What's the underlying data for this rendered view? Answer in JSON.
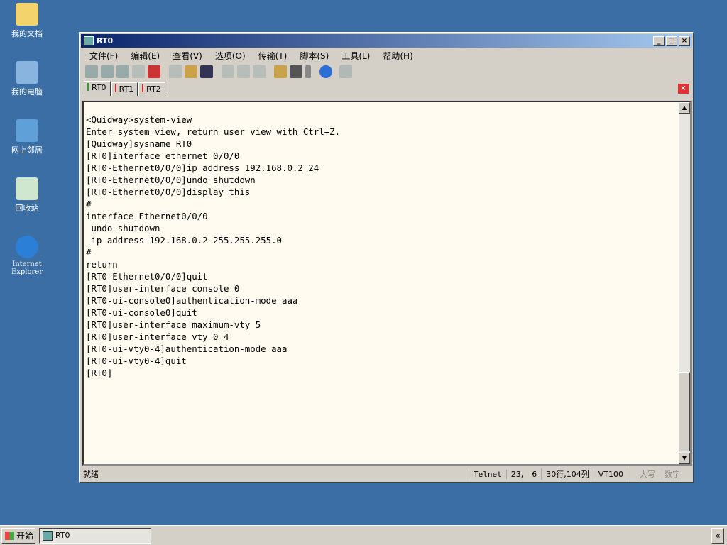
{
  "desktop": [
    "我的文档",
    "我的电脑",
    "网上邻居",
    "回收站",
    "Internet Explorer"
  ],
  "window": {
    "title": "RT0",
    "menu": [
      "文件(F)",
      "编辑(E)",
      "查看(V)",
      "选项(O)",
      "传输(T)",
      "脚本(S)",
      "工具(L)",
      "帮助(H)"
    ],
    "tabs": [
      {
        "label": "RT0",
        "color": "#2ca02c"
      },
      {
        "label": "RT1",
        "color": "#d62728"
      },
      {
        "label": "RT2",
        "color": "#d62728"
      }
    ],
    "terminal": "<Quidway>system-view\nEnter system view, return user view with Ctrl+Z.\n[Quidway]sysname RT0\n[RT0]interface ethernet 0/0/0\n[RT0-Ethernet0/0/0]ip address 192.168.0.2 24\n[RT0-Ethernet0/0/0]undo shutdown\n[RT0-Ethernet0/0/0]display this\n#\ninterface Ethernet0/0/0\n undo shutdown\n ip address 192.168.0.2 255.255.255.0\n#\nreturn\n[RT0-Ethernet0/0/0]quit\n[RT0]user-interface console 0\n[RT0-ui-console0]authentication-mode aaa\n[RT0-ui-console0]quit\n[RT0]user-interface maximum-vty 5\n[RT0]user-interface vty 0 4\n[RT0-ui-vty0-4]authentication-mode aaa\n[RT0-ui-vty0-4]quit\n[RT0]",
    "status": {
      "ready": "就绪",
      "protocol": "Telnet",
      "row": "23,",
      "col": "6",
      "size": "30行,104列",
      "emulation": "VT100",
      "caps": "大写",
      "num": "数字"
    }
  },
  "taskbar": {
    "start": "开始",
    "task": "RT0",
    "chevron": "«"
  }
}
